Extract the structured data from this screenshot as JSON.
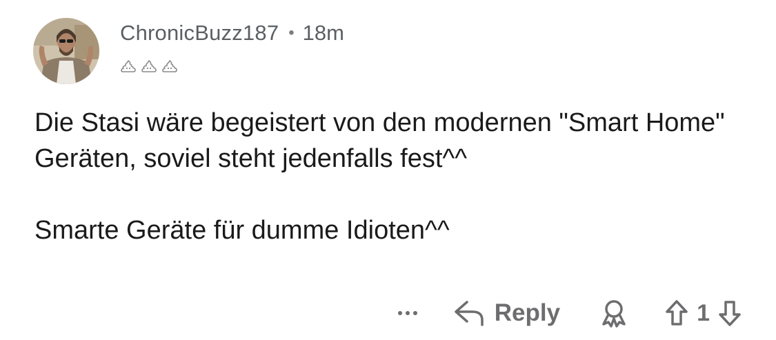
{
  "comment": {
    "username": "ChronicBuzz187",
    "separator": "•",
    "age": "18m",
    "flair_icons": [
      "poop-icon",
      "poop-icon",
      "poop-icon"
    ],
    "paragraphs": [
      "Die Stasi wäre begeistert von den modernen \"Smart Home\" Geräten, soviel steht jedenfalls fest^^",
      "Smarte Geräte für dumme Idioten^^"
    ]
  },
  "actions": {
    "more_icon": "more-icon",
    "reply_icon": "reply-arrow-icon",
    "reply_label": "Reply",
    "award_icon": "award-icon",
    "upvote_icon": "upvote-arrow-icon",
    "vote_count": "1",
    "downvote_icon": "downvote-arrow-icon"
  },
  "colors": {
    "text": "#1a1a1b",
    "meta": "#5b5f63",
    "action": "#6d6d6f",
    "background": "#ffffff"
  }
}
